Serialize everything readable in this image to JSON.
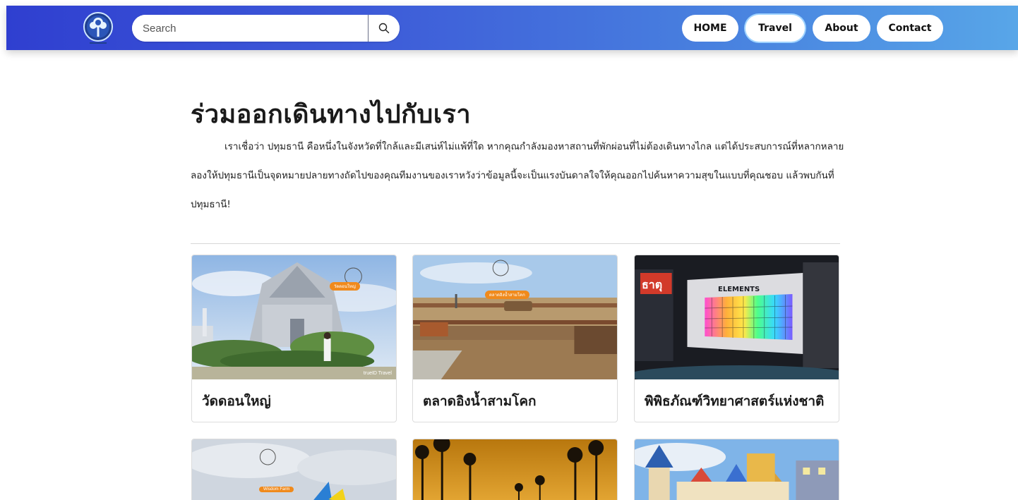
{
  "header": {
    "search": {
      "placeholder": "Search",
      "value": ""
    },
    "nav": [
      {
        "label": "HOME",
        "active": false
      },
      {
        "label": "Travel",
        "active": true
      },
      {
        "label": "About",
        "active": false
      },
      {
        "label": "Contact",
        "active": false
      }
    ],
    "icons": {
      "logo": "tree-logo-icon",
      "search": "search-icon"
    }
  },
  "main": {
    "title": "ร่วมออกเดินทางไปกับเรา",
    "intro": "เราเชื่อว่า ปทุมธานี คือหนึ่งในจังหวัดที่ใกล้และมีเสน่ห์ไม่แพ้ที่ใด หากคุณกำลังมองหาสถานที่พักผ่อนที่ไม่ต้องเดินทางไกล แต่ได้ประสบการณ์ที่หลากหลาย ลองให้ปทุมธานีเป็นจุดหมายปลายทางถัดไปของคุณทีมงานของเราหวังว่าข้อมูลนี้จะเป็นแรงบันดาลใจให้คุณออกไปค้นหาความสุขในแบบที่คุณชอบ แล้วพบกันที่ปทุมธานี!"
  },
  "cards": [
    {
      "title": "วัดดอนใหญ่",
      "badge": "วัดดอนใหญ่",
      "watermark": "trueID Travel"
    },
    {
      "title": "ตลาดอิงน้ำสามโคก",
      "badge": "ตลาดอิงน้ำสามโคก",
      "watermark": ""
    },
    {
      "title": "พิพิธภัณฑ์วิทยาศาสตร์แห่งชาติ",
      "badge": "",
      "sign": "ธาตุ",
      "wall_text": "ELEMENTS"
    },
    {
      "title": "",
      "badge": "Wisdom Farm"
    },
    {
      "title": ""
    },
    {
      "title": ""
    }
  ],
  "colors": {
    "nav_gradient_start": "#2f3fd0",
    "nav_gradient_end": "#58a6e8",
    "badge_orange": "#f08a1c",
    "active_ring": "#9fd3ff"
  }
}
